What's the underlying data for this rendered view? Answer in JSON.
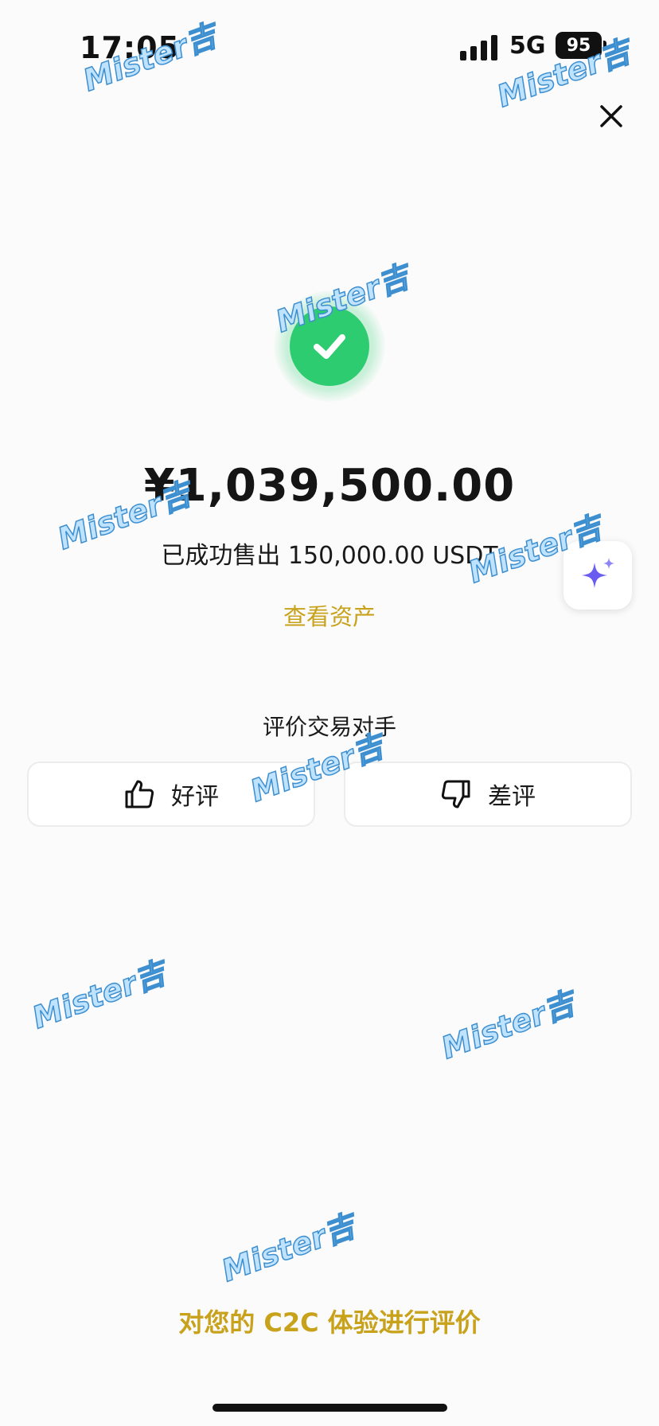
{
  "status_bar": {
    "time": "17:05",
    "network": "5G",
    "battery": "95"
  },
  "result": {
    "amount": "¥1,039,500.00",
    "sold_text": "已成功售出 150,000.00 USDT",
    "view_assets_label": "查看资产"
  },
  "rating": {
    "title": "评价交易对手",
    "good_label": "好评",
    "bad_label": "差评"
  },
  "footer": {
    "feedback_label": "对您的 C2C 体验进行评价"
  },
  "watermark": {
    "text": "Mister吉"
  },
  "colors": {
    "success": "#2ecc71",
    "accent_gold": "#c9a21c",
    "ai_sparkle": "#6a5cf0"
  }
}
